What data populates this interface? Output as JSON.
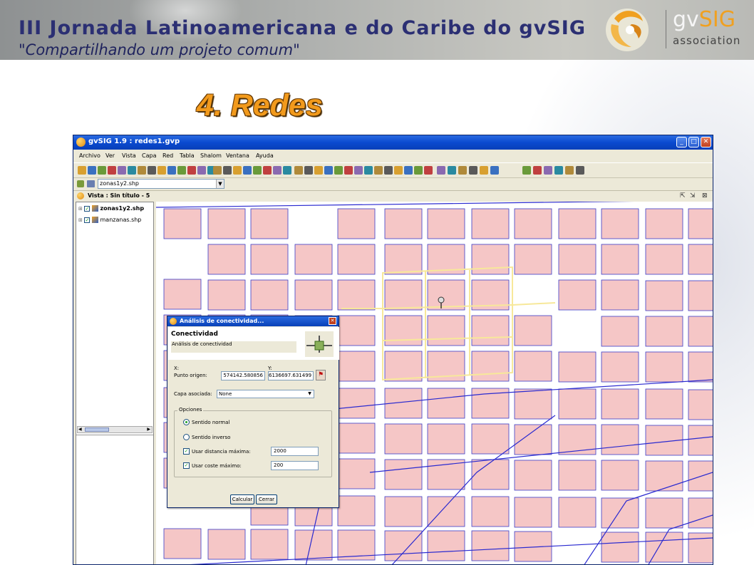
{
  "slide": {
    "banner_title": "III Jornada Latinoamericana e do Caribe do gvSIG",
    "banner_subtitle": "\"Compartilhando um projeto comum\"",
    "logo_gv": "gv",
    "logo_sig": "SIG",
    "logo_assoc": "association",
    "heading": "4. Redes",
    "colors": {
      "title_blue": "#2b2f73",
      "heading_orange": "#f29a1c",
      "logo_orange": "#f0a020"
    }
  },
  "window": {
    "title": "gvSIG 1.9 : redes1.gvp",
    "controls": [
      "_",
      "□",
      "✕"
    ]
  },
  "menu": [
    "Archivo",
    "Ver",
    "Vista",
    "Capa",
    "Red",
    "Tabla",
    "Shalom",
    "Ventana",
    "Ayuda"
  ],
  "layer_selector": {
    "value": "zonas1y2.shp"
  },
  "view": {
    "title": "Vista : Sin título - 5",
    "controls": [
      "⇱",
      "⇲",
      "⊠"
    ]
  },
  "toc": {
    "layers": [
      {
        "name": "zonas1y2.shp",
        "checked": true,
        "bold": true
      },
      {
        "name": "manzanas.shp",
        "checked": true,
        "bold": false
      }
    ]
  },
  "map": {
    "colors": {
      "block_fill": "#f5c6c6",
      "block_stroke": "#3c3cc8",
      "street_line": "#2a2ad0",
      "route_highlight": "#f7e89a"
    }
  },
  "dialog": {
    "title": "Análisis de conectividad...",
    "heading": "Conectividad",
    "description": "Análisis de conectividad",
    "origin_label": "Punto origen:",
    "x_label": "X:",
    "y_label": "Y:",
    "x_value": "574142.580856",
    "y_value": "6136697.631499",
    "layer_label": "Capa asociada:",
    "layer_value": "None",
    "options_label": "Opciones",
    "option_normal": "Sentido normal",
    "option_inverse": "Sentido inverso",
    "selected_direction": "Sentido normal",
    "max_distance_label": "Usar distancia máxima:",
    "max_distance_checked": true,
    "max_distance_value": "2000",
    "max_cost_label": "Usar coste máximo:",
    "max_cost_checked": true,
    "max_cost_value": "200",
    "calculate_label": "Calcular",
    "close_label": "Cerrar"
  }
}
